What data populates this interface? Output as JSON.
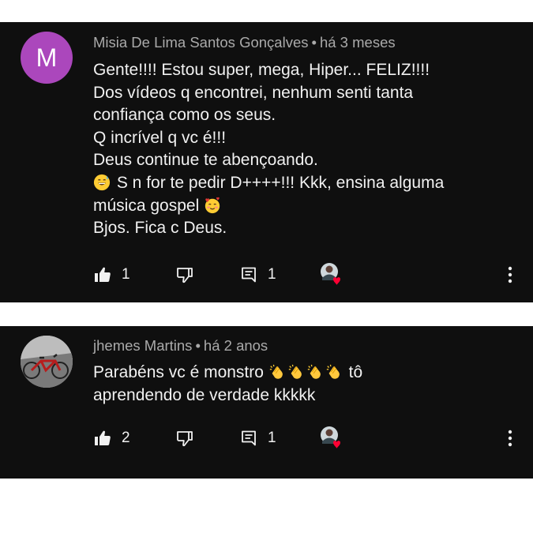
{
  "colors": {
    "card_bg": "#0f0f0f",
    "text": "#f1f1f1",
    "meta": "#aaaaaa",
    "avatar_m": "#ab47bc",
    "heart": "#ff0033"
  },
  "comments": [
    {
      "avatar_letter": "M",
      "author": "Misia De Lima Santos Gonçalves",
      "separator": "•",
      "time": "há 3 meses",
      "lines": [
        "Gente!!!! Estou super, mega, Hiper... FELIZ!!!!",
        "Dos vídeos q encontrei, nenhum senti tanta",
        "confiança como os seus.",
        "Q incrível q vc é!!!",
        "Deus continue te abençoando.",
        "S n for te pedir D++++!!! Kkk, ensina alguma",
        "música gospel",
        "Bjos. Fica c Deus."
      ],
      "emojis": [
        "grinning-sweat-emoji",
        "smiling-face-hearts-emoji"
      ],
      "likes": "1",
      "replies": "1",
      "icons": [
        "thumbs-up-icon",
        "thumbs-down-icon",
        "replies-icon",
        "creator-heart-icon",
        "more-options-icon"
      ]
    },
    {
      "avatar_image": "bicycle-photo",
      "author": "jhemes Martins",
      "separator": "•",
      "time": "há 2 anos",
      "lines": [
        "Parabéns vc é monstro",
        "tô",
        "aprendendo de verdade kkkkk"
      ],
      "emojis": [
        "clapping-hands-emoji"
      ],
      "likes": "2",
      "replies": "1",
      "icons": [
        "thumbs-up-icon",
        "thumbs-down-icon",
        "replies-icon",
        "creator-heart-icon",
        "more-options-icon"
      ]
    }
  ]
}
